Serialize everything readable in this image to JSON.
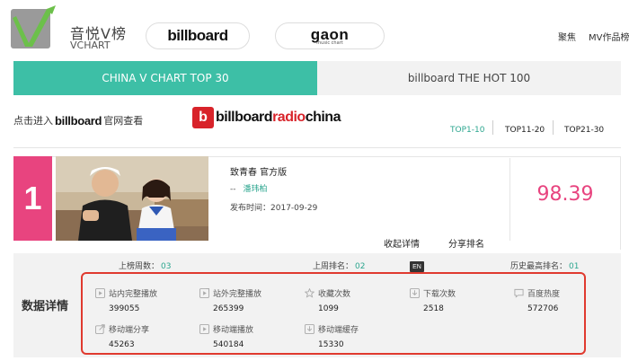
{
  "header": {
    "logo_text": "音悦V榜",
    "logo_sub": "VCHART",
    "partners": [
      "billboard",
      "gaon"
    ],
    "gaon_sub": "music chart",
    "nav": [
      "聚焦",
      "MV作品榜"
    ]
  },
  "tabs": [
    {
      "label": "CHINA V CHART TOP 30",
      "active": true
    },
    {
      "label": "billboard THE HOT 100",
      "active": false
    }
  ],
  "subbar": {
    "prefix": "点击进入",
    "brand": "billboard",
    "suffix": "官网查看",
    "brc_icon": "b",
    "brc_billboard": "billboard",
    "brc_radio": "radio",
    "brc_china": "china"
  },
  "range_tabs": [
    {
      "label": "TOP1-10",
      "active": true
    },
    {
      "label": "TOP11-20",
      "active": false
    },
    {
      "label": "TOP21-30",
      "active": false
    }
  ],
  "entry": {
    "rank": "1",
    "title": "致青春 官方版",
    "artist_prefix": "--",
    "artist": "潘玮柏",
    "date_label": "发布时间：",
    "date": "2017-09-29",
    "actions": [
      "收起详情",
      "分享排名"
    ],
    "score": "98.39"
  },
  "details": {
    "label": "数据详情",
    "en_badge": "EN",
    "top_stats": [
      {
        "label": "上榜周数：",
        "value": "03"
      },
      {
        "label": "上周排名：",
        "value": "02"
      },
      {
        "label": "历史最高排名：",
        "value": "01"
      }
    ],
    "metrics": [
      {
        "label": "站内完整播放",
        "value": "399055",
        "icon": "play-icon"
      },
      {
        "label": "站外完整播放",
        "value": "265399",
        "icon": "external-play-icon"
      },
      {
        "label": "收藏次数",
        "value": "1099",
        "icon": "star-icon"
      },
      {
        "label": "下载次数",
        "value": "2518",
        "icon": "download-icon"
      },
      {
        "label": "百度热度",
        "value": "572706",
        "icon": "comment-icon"
      },
      {
        "label": "移动端分享",
        "value": "45263",
        "icon": "share-icon"
      },
      {
        "label": "移动端播放",
        "value": "540184",
        "icon": "mobile-play-icon"
      },
      {
        "label": "移动端缓存",
        "value": "15330",
        "icon": "cache-icon"
      }
    ]
  },
  "colors": {
    "accent": "#3dbfa6",
    "rank": "#e8447f",
    "highlight_frame": "#e03a2f",
    "link": "#2ca68f"
  }
}
